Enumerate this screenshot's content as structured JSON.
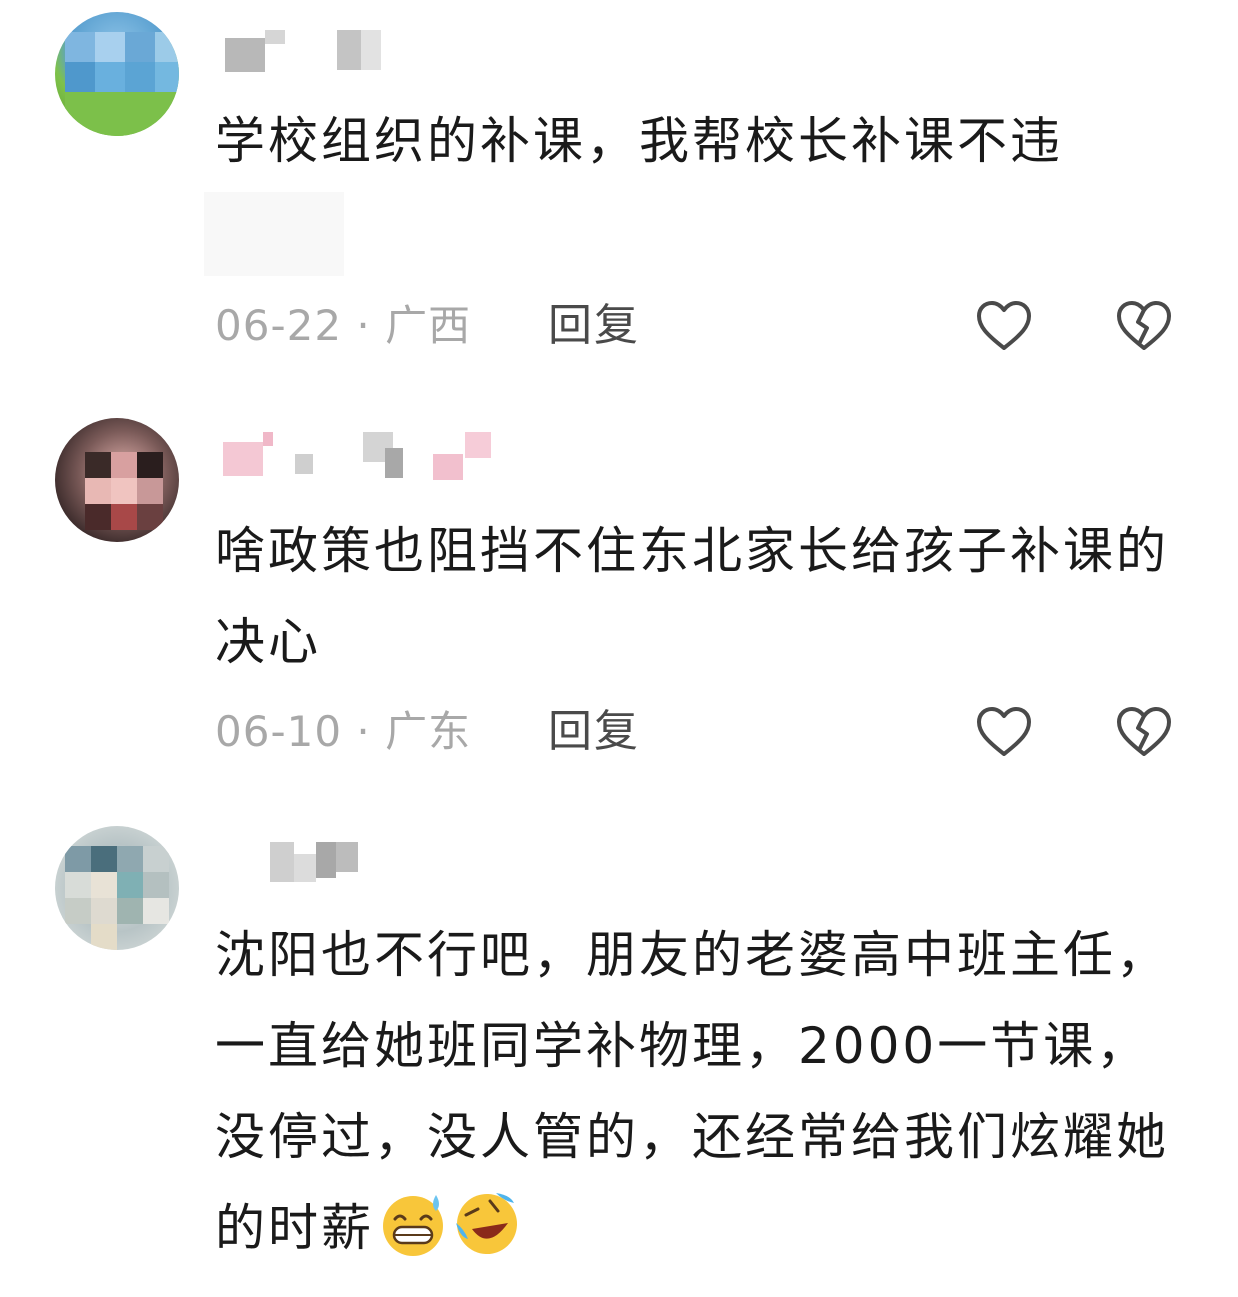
{
  "comments": [
    {
      "text": "学校组织的补课，我帮校长补课不违",
      "date": "06-22",
      "separator": "·",
      "location": "广西",
      "reply_label": "回复"
    },
    {
      "text": "啥政策也阻挡不住东北家长给孩子补课的决心",
      "date": "06-10",
      "separator": "·",
      "location": "广东",
      "reply_label": "回复"
    },
    {
      "text": "沈阳也不行吧，朋友的老婆高中班主任，一直给她班同学补物理，2000一节课，没停过，没人管的，还经常给我们炫耀她的时薪",
      "emojis": [
        "sweat-grin-emoji",
        "laugh-cry-emoji"
      ]
    }
  ],
  "colors": {
    "meta": "#a8a8a8",
    "reply": "#4a4a4a",
    "icon_stroke": "#4a4a4a"
  },
  "icons": [
    "heart-icon",
    "broken-heart-icon"
  ]
}
